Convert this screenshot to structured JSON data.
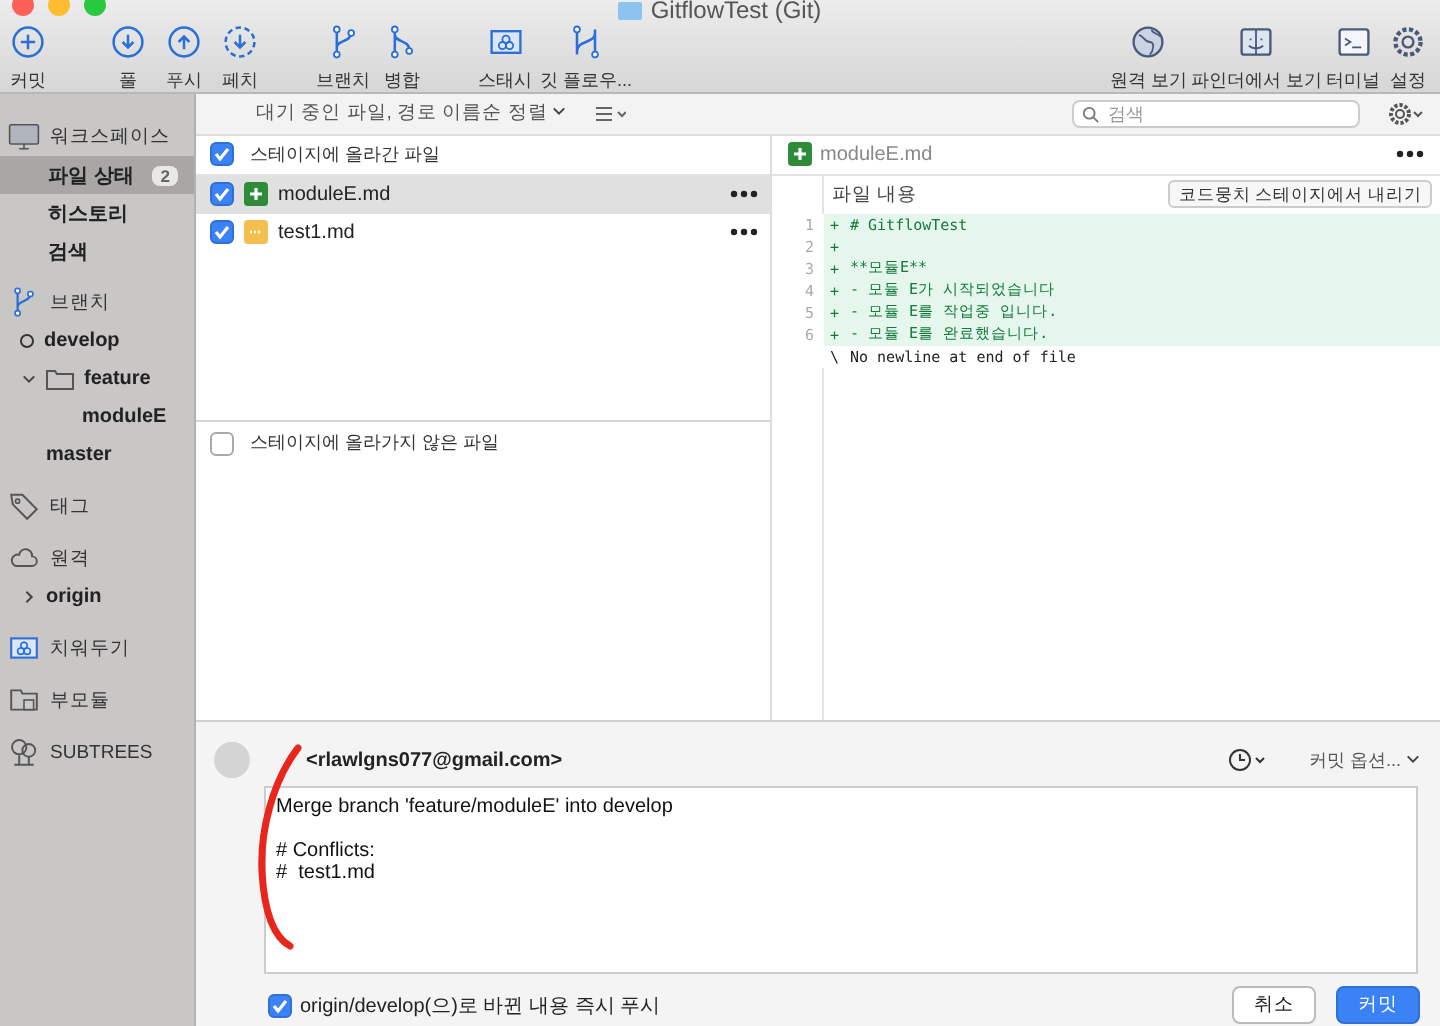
{
  "window": {
    "title": "GitflowTest (Git)"
  },
  "toolbar": {
    "groups": [
      [
        {
          "label": "커밋"
        }
      ],
      [
        {
          "label": "풀"
        },
        {
          "label": "푸시"
        },
        {
          "label": "페치"
        }
      ],
      [
        {
          "label": "브랜치"
        },
        {
          "label": "병합"
        }
      ],
      [
        {
          "label": "스태시"
        },
        {
          "label": "깃 플로우..."
        }
      ],
      [
        {
          "label": "원격 보기"
        },
        {
          "label": "파인더에서 보기"
        },
        {
          "label": "터미널"
        },
        {
          "label": "설정"
        }
      ]
    ]
  },
  "filter_bar": {
    "sort": "대기 중인 파일, 경로 이름순 정렬",
    "search": {
      "placeholder": "검색"
    }
  },
  "sidebar": {
    "sections": [
      {
        "label": "워크스페이스",
        "items": [
          {
            "label": "파일 상태",
            "badge": "2",
            "selected": true
          },
          {
            "label": "히스토리",
            "selected": false
          },
          {
            "label": "검색",
            "selected": false
          }
        ]
      },
      {
        "label": "브랜치",
        "items": [
          {
            "label": "develop",
            "kind": "branch",
            "current": true
          },
          {
            "label": "feature",
            "kind": "folder",
            "expanded": true,
            "children": [
              {
                "label": "moduleE",
                "kind": "branch",
                "current": false
              }
            ]
          },
          {
            "label": "master",
            "kind": "branch",
            "current": false
          }
        ]
      },
      {
        "label": "태그"
      },
      {
        "label": "원격",
        "items": [
          {
            "label": "origin",
            "kind": "remote",
            "expanded": false
          }
        ]
      },
      {
        "label": "치워두기"
      },
      {
        "label": "부모듈"
      },
      {
        "label": "SUBTREES"
      }
    ]
  },
  "staged": {
    "label": "스테이지에 올라간 파일",
    "checked": true,
    "files": [
      {
        "name": "moduleE.md",
        "kind": "added",
        "checked": true,
        "selected": true
      },
      {
        "name": "test1.md",
        "kind": "modified",
        "checked": true,
        "selected": false
      }
    ]
  },
  "unstaged": {
    "label": "스테이지에 올라가지 않은 파일",
    "checked": false
  },
  "diff": {
    "file": "moduleE.md",
    "kind": "added",
    "hunk_title": "파일 내용",
    "hunk_button": "코드뭉치 스테이지에서 내리기",
    "lines": [
      {
        "number": "1",
        "sign": "+",
        "text": "# GitflowTest",
        "kind": "added"
      },
      {
        "number": "2",
        "sign": "+",
        "kind": "added"
      },
      {
        "number": "3",
        "sign": "+",
        "text": "**모듈E**",
        "kind": "added"
      },
      {
        "number": "4",
        "sign": "+",
        "text": "- 모듈 E가 시작되었습니다",
        "kind": "added"
      },
      {
        "number": "5",
        "sign": "+",
        "text": "- 모듈 E를 작업중 입니다.",
        "kind": "added"
      },
      {
        "number": "6",
        "sign": "+",
        "text": "- 모듈 E를 완료했습니다.",
        "kind": "added"
      },
      {
        "sign": "\\",
        "text": "No newline at end of file",
        "kind": "note"
      }
    ]
  },
  "commit": {
    "author": "<rlawlgns077@gmail.com>",
    "options": "커밋 옵션...",
    "message": "Merge branch 'feature/moduleE' into develop\n\n# Conflicts:\n#\ttest1.md\n",
    "push": {
      "label": "origin/develop(으)로 바뀐 내용 즉시 푸시",
      "checked": true
    },
    "buttons": [
      {
        "label": "취소",
        "kind": "secondary"
      },
      {
        "label": "커밋",
        "kind": "primary"
      }
    ]
  }
}
